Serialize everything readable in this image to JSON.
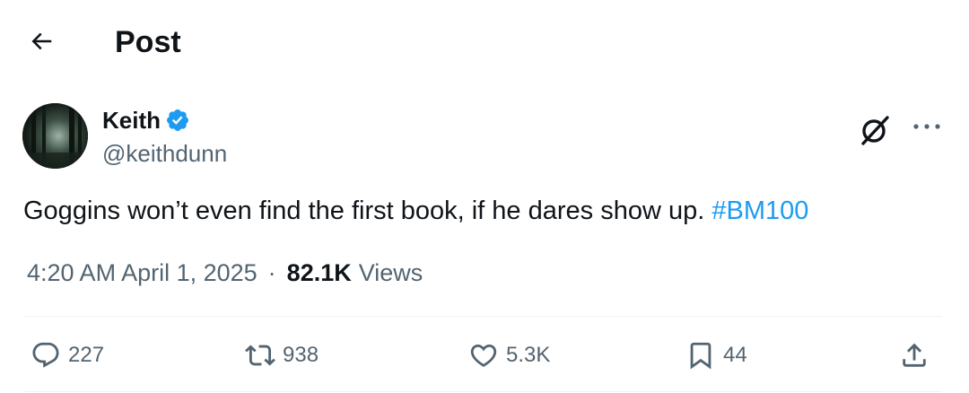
{
  "header": {
    "title": "Post",
    "back_icon": "arrow-left-icon"
  },
  "author": {
    "name": "Keith",
    "handle": "@keithdunn",
    "verified": true,
    "verified_color": "#1d9bf0"
  },
  "tweet": {
    "text": "Goggins won’t even find the first book, if he dares show up.",
    "hashtag": "#BM100",
    "time": "4:20 AM April 1, 2025",
    "separator": "·",
    "views_count": "82.1K",
    "views_label": "Views"
  },
  "actions": {
    "replies": "227",
    "reposts": "938",
    "likes": "5.3K",
    "bookmarks": "44"
  },
  "colors": {
    "accent": "#1d9bf0",
    "text": "#0f1419",
    "secondary": "#536471"
  }
}
